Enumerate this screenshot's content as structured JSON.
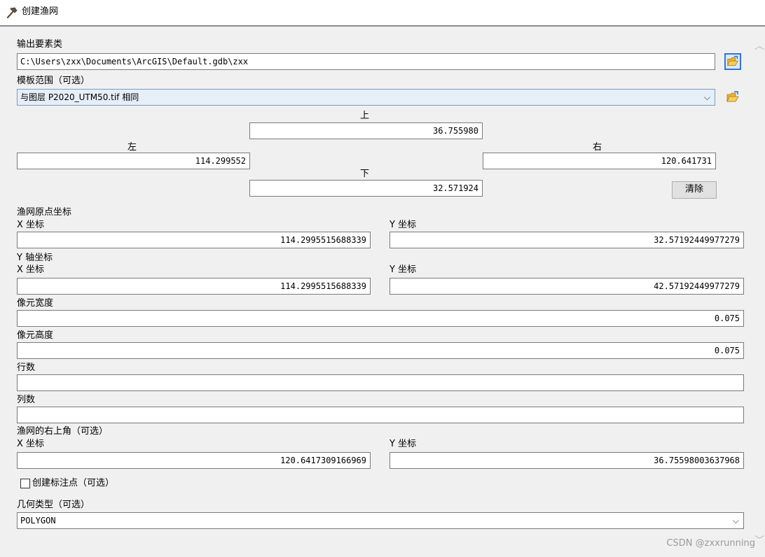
{
  "window": {
    "title": "创建渔网"
  },
  "output_features": {
    "label": "输出要素类",
    "value": "C:\\Users\\zxx\\Documents\\ArcGIS\\Default.gdb\\zxx"
  },
  "template_extent": {
    "label": "模板范围（可选）",
    "selected": "与图层 P2020_UTM50.tif 相同",
    "top_label": "上",
    "top_value": "36.755980",
    "left_label": "左",
    "left_value": "114.299552",
    "right_label": "右",
    "right_value": "120.641731",
    "bottom_label": "下",
    "bottom_value": "32.571924",
    "clear_label": "清除"
  },
  "origin": {
    "label": "渔网原点坐标",
    "x_label": "X 坐标",
    "x_value": "114.2995515688339",
    "y_label": "Y 坐标",
    "y_value": "32.57192449977279"
  },
  "y_axis": {
    "label": "Y 轴坐标",
    "x_label": "X 坐标",
    "x_value": "114.2995515688339",
    "y_label": "Y 坐标",
    "y_value": "42.57192449977279"
  },
  "cell_width": {
    "label": "像元宽度",
    "value": "0.075"
  },
  "cell_height": {
    "label": "像元高度",
    "value": "0.075"
  },
  "rows": {
    "label": "行数",
    "value": ""
  },
  "columns": {
    "label": "列数",
    "value": ""
  },
  "opposite_corner": {
    "label": "渔网的右上角（可选）",
    "x_label": "X 坐标",
    "x_value": "120.6417309166969",
    "y_label": "Y 坐标",
    "y_value": "36.75598003637968"
  },
  "create_labels": {
    "label": "创建标注点（可选）",
    "checked": false
  },
  "geometry_type": {
    "label": "几何类型（可选）",
    "value": "POLYGON"
  },
  "watermark": "CSDN @zxxrunning",
  "icons": {
    "title": "hammer-icon",
    "browse": "folder-open-icon",
    "dropdown": "chevron-down-icon",
    "scroll_up": "scroll-up-icon",
    "scroll_down": "scroll-down-icon"
  }
}
